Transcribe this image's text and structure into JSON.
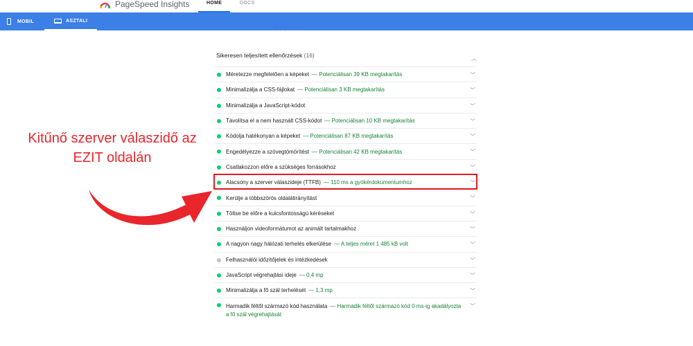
{
  "topbar": {
    "brand": "PageSpeed Insights",
    "nav": [
      "HOME",
      "DOCS"
    ]
  },
  "tabs": [
    {
      "label": "MOBIL",
      "icon": "phone-icon"
    },
    {
      "label": "ASZTALI",
      "icon": "laptop-icon",
      "active": true
    }
  ],
  "section": {
    "title": "Sikeresen teljesített ellenőrzések",
    "count": "(16)"
  },
  "audits": [
    {
      "label": "Méretezze megfelelően a képeket",
      "saving": "— Potenciálisan 39 KB megtakarítás",
      "status": "pass"
    },
    {
      "label": "Minimalizálja a CSS-fájlokat",
      "saving": "— Potenciálisan 3 KB megtakarítás",
      "status": "pass"
    },
    {
      "label": "Minimalizálja a JavaScript-kódot",
      "saving": "",
      "status": "pass"
    },
    {
      "label": "Távolítsa el a nem használt CSS-kódot",
      "saving": "— Potenciálisan 10 KB megtakarítás",
      "status": "pass"
    },
    {
      "label": "Kódolja hatékonyan a képeket",
      "saving": "— Potenciálisan 87 KB megtakarítás",
      "status": "pass"
    },
    {
      "label": "Engedélyezze a szövegtömörítést",
      "saving": "— Potenciálisan 42 KB megtakarítás",
      "status": "pass"
    },
    {
      "label": "Csatlakozzon előre a szükséges forrásokhoz",
      "saving": "",
      "status": "pass"
    },
    {
      "label": "Alacsony a szerver válaszideje (TTFB)",
      "saving": "— 110 ms a gyökérdokumentumhoz",
      "status": "pass"
    },
    {
      "label": "Kerülje a többszörös oldalátirányítást",
      "saving": "",
      "status": "pass"
    },
    {
      "label": "Töltse be előre a kulcsfontosságú kéréseket",
      "saving": "",
      "status": "pass"
    },
    {
      "label": "Használjon videoformátumot az animált tartalmakhoz",
      "saving": "",
      "status": "pass"
    },
    {
      "label": "A nagyon nagy hálózati terhelés elkerülése",
      "saving": "— A teljes méret 1 485 kB volt",
      "status": "pass"
    },
    {
      "label": "Felhasználói időzítőjelek és intézkedések",
      "saving": "",
      "status": "info"
    },
    {
      "label": "JavaScript végrehajtási ideje",
      "saving": "— 0,4 mp",
      "status": "pass"
    },
    {
      "label": "Minimalizálja a fő szál terhelését",
      "saving": "— 1,3 mp",
      "status": "pass"
    },
    {
      "label": "Harmadik féltől származó kód használata",
      "saving": "— Harmadik féltől származó kód 0 ms-ig akadályozta a fő szál végrehajtását",
      "status": "pass"
    }
  ],
  "annotation": {
    "line1": "Kitűnő szerver válaszidő az",
    "line2": "EZIT oldalán"
  },
  "colors": {
    "accent_blue": "#3c7fe6",
    "pass_green": "#0cce6b",
    "saving_green": "#188038",
    "highlight_red": "#e11b22"
  }
}
